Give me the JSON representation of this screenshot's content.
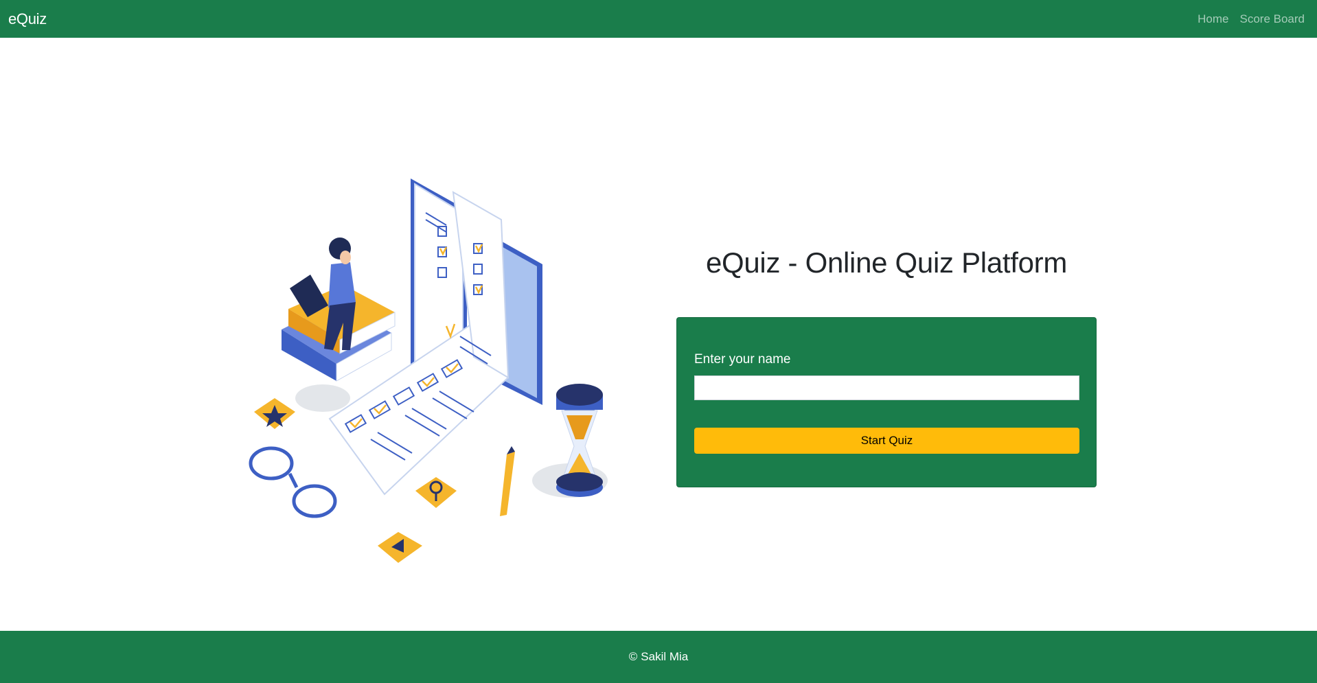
{
  "navbar": {
    "brand": "eQuiz",
    "links": [
      {
        "label": "Home"
      },
      {
        "label": "Score Board"
      }
    ]
  },
  "hero": {
    "title": "eQuiz - Online Quiz Platform",
    "illustration_icon": "quiz-illustration"
  },
  "form": {
    "label": "Enter your name",
    "input_value": "",
    "input_placeholder": "",
    "button_label": "Start Quiz"
  },
  "footer": {
    "copyright_symbol": "©",
    "author": "Sakil Mia"
  },
  "colors": {
    "primary_green": "#1a7d4b",
    "button_yellow": "#ffbb0a",
    "accent_blue": "#3d5fc4",
    "accent_orange": "#f5b52c"
  }
}
